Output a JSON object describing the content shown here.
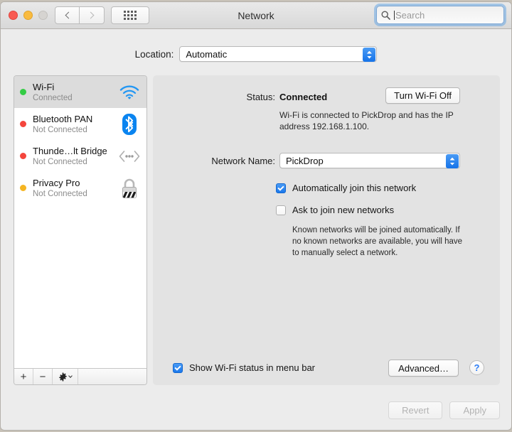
{
  "window": {
    "title": "Network"
  },
  "titlebar": {
    "close_label": "Close",
    "minimize_label": "Minimize",
    "zoom_label": "Zoom",
    "back_label": "Back",
    "forward_label": "Forward",
    "showall_label": "Show All"
  },
  "search": {
    "value": "",
    "placeholder": "Search"
  },
  "location": {
    "label": "Location:",
    "value": "Automatic"
  },
  "sidebar": {
    "services": [
      {
        "name": "Wi-Fi",
        "state": "Connected",
        "dot": "#33cc44",
        "icon": "wifi-icon",
        "selected": true
      },
      {
        "name": "Bluetooth PAN",
        "state": "Not Connected",
        "dot": "#f4453c",
        "icon": "bluetooth-icon",
        "selected": false
      },
      {
        "name": "Thunde…lt Bridge",
        "state": "Not Connected",
        "dot": "#f4453c",
        "icon": "thunderbolt-bridge-icon",
        "selected": false
      },
      {
        "name": "Privacy Pro",
        "state": "Not Connected",
        "dot": "#f5b521",
        "icon": "lock-icon",
        "selected": false
      }
    ],
    "add_label": "+",
    "remove_label": "−",
    "actions_label": "Actions"
  },
  "main": {
    "status_label": "Status:",
    "status_value": "Connected",
    "turn_off_button": "Turn Wi-Fi Off",
    "status_description": "Wi-Fi is connected to PickDrop and has the IP address 192.168.1.100.",
    "network_name_label": "Network Name:",
    "network_name_value": "PickDrop",
    "auto_join_label": "Automatically join this network",
    "auto_join_checked": true,
    "ask_join_label": "Ask to join new networks",
    "ask_join_checked": false,
    "join_description": "Known networks will be joined automatically. If no known networks are available, you will have to manually select a network.",
    "show_status_label": "Show Wi-Fi status in menu bar",
    "show_status_checked": true,
    "advanced_button": "Advanced…",
    "help_button": "?"
  },
  "footer": {
    "revert_button": "Revert",
    "apply_button": "Apply"
  },
  "colors": {
    "accent": "#1a78ec",
    "connected": "#33cc44",
    "disconnected": "#f4453c",
    "warning": "#f5b521"
  }
}
